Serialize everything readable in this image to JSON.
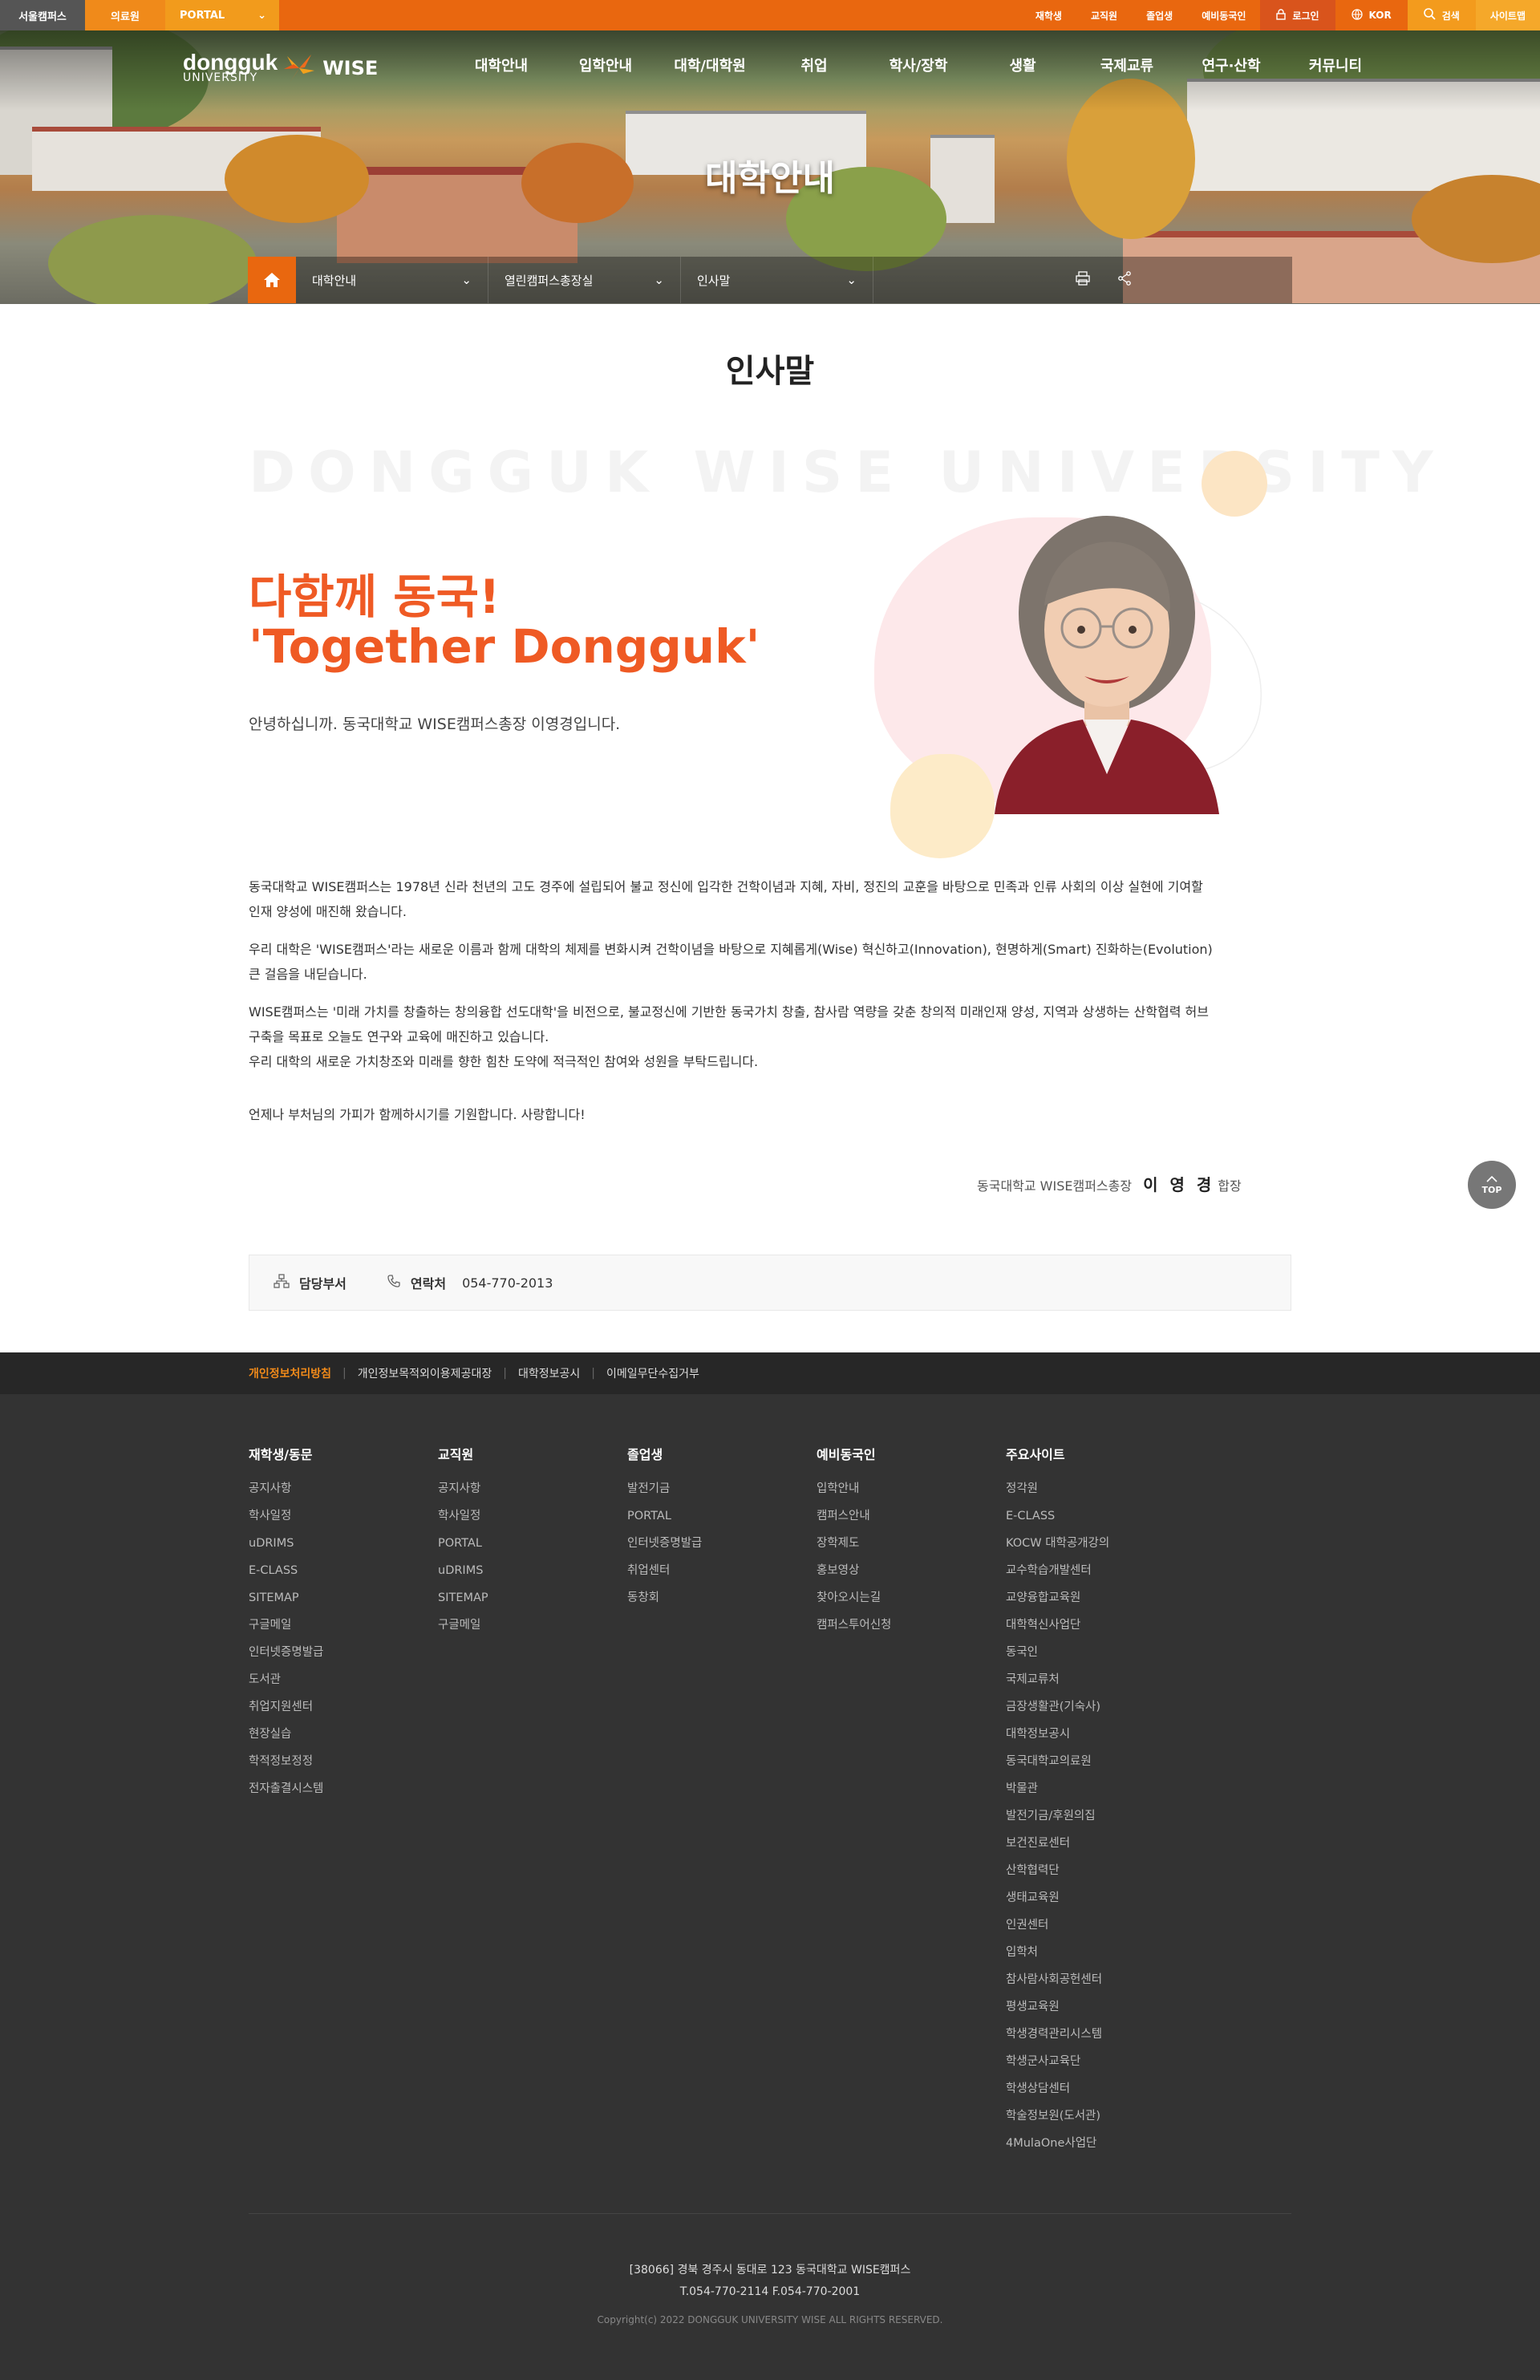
{
  "topbar": {
    "left": [
      "서울캠퍼스",
      "의료원",
      "PORTAL"
    ],
    "right": [
      "재학생",
      "교직원",
      "졸업생",
      "예비동국인"
    ],
    "login": "로그인",
    "lang": "KOR",
    "search": "검색",
    "sitemap": "사이트맵"
  },
  "header": {
    "logo_main": "dongguk",
    "logo_sub": "UNIVERSITY",
    "logo_wise": "WISE",
    "gnb": [
      "대학안내",
      "입학안내",
      "대학/대학원",
      "취업",
      "학사/장학",
      "생활",
      "국제교류",
      "연구·산학",
      "커뮤니티"
    ],
    "hero_title": "대학안내"
  },
  "location": {
    "depth1": "대학안내",
    "depth2": "열린캠퍼스총장실",
    "depth3": "인사말"
  },
  "content": {
    "page_title": "인사말",
    "watermark": "DONGGUK WISE UNIVERSITY",
    "slogan1": "다함께 동국!",
    "slogan2": "'Together Dongguk'",
    "greeting": "안녕하십니까. 동국대학교 WISE캠퍼스총장 이영경입니다.",
    "p1a": "동국대학교 WISE캠퍼스는 1978년 신라 천년의 고도 경주에 설립되어 불교 정신에 입각한 건학이념과 지혜, 자비, 정진의 교훈을 바탕으로 민족과 인류 사회의 이상 실현에 기여할",
    "p1b": "인재 양성에 매진해 왔습니다.",
    "p2a": "우리 대학은 'WISE캠퍼스'라는 새로운 이름과 함께 대학의 체제를 변화시켜 건학이념을 바탕으로 지혜롭게(Wise) 혁신하고(Innovation), 현명하게(Smart) 진화하는(Evolution)",
    "p2b": "큰 걸음을 내딛습니다.",
    "p3a": "WISE캠퍼스는 '미래 가치를 창출하는 창의융합 선도대학'을 비전으로, 불교정신에 기반한 동국가치 창출, 참사람 역량을 갖춘 창의적 미래인재 양성, 지역과 상생하는 산학협력 허브",
    "p3b": "구축을 목표로 오늘도 연구와 교육에 매진하고 있습니다.",
    "p3c": "우리 대학의 새로운 가치창조와 미래를 향한 힘찬 도약에 적극적인 참여와 성원을 부탁드립니다.",
    "p4": "언제나 부처님의 가피가 함께하시기를 기원합니다. 사랑합니다!",
    "sign_org": "동국대학교 WISE캠퍼스총장",
    "sign_name": "이 영 경",
    "sign_suffix": "합장",
    "top_btn": "TOP"
  },
  "contact": {
    "dept_label": "담당부서",
    "phone_label": "연락처",
    "phone": "054-770-2013"
  },
  "footer": {
    "links": [
      "개인정보처리방침",
      "개인정보목적외이용제공대장",
      "대학정보공시",
      "이메일무단수집거부"
    ],
    "columns": [
      {
        "title": "재학생/동문",
        "items": [
          "공지사항",
          "학사일정",
          "uDRIMS",
          "E-CLASS",
          "SITEMAP",
          "구글메일",
          "인터넷증명발급",
          "도서관",
          "취업지원센터",
          "현장실습",
          "학적정보정정",
          "전자출결시스템"
        ]
      },
      {
        "title": "교직원",
        "items": [
          "공지사항",
          "학사일정",
          "PORTAL",
          "uDRIMS",
          "SITEMAP",
          "구글메일"
        ]
      },
      {
        "title": "졸업생",
        "items": [
          "발전기금",
          "PORTAL",
          "인터넷증명발급",
          "취업센터",
          "동창회"
        ]
      },
      {
        "title": "예비동국인",
        "items": [
          "입학안내",
          "캠퍼스안내",
          "장학제도",
          "홍보영상",
          "찾아오시는길",
          "캠퍼스투어신청"
        ]
      },
      {
        "title": "주요사이트",
        "items": [
          "정각원",
          "E-CLASS",
          "KOCW 대학공개강의",
          "교수학습개발센터",
          "교양융합교육원",
          "대학혁신사업단",
          "동국인",
          "국제교류처",
          "금장생활관(기숙사)",
          "대학정보공시",
          "동국대학교의료원",
          "박물관",
          "발전기금/후원의집",
          "보건진료센터",
          "산학협력단",
          "생태교육원",
          "인권센터",
          "입학처",
          "참사람사회공헌센터",
          "평생교육원",
          "학생경력관리시스템",
          "학생군사교육단",
          "학생상담센터",
          "학술정보원(도서관)",
          "4MulaOne사업단"
        ]
      }
    ],
    "address": "[38066] 경북 경주시 동대로 123 동국대학교 WISE캠퍼스",
    "tel": "T.054-770-2114 F.054-770-2001",
    "copyright": "Copyright(c) 2022 DONGGUK UNIVERSITY WISE ALL RIGHTS RESERVED."
  },
  "colors": {
    "brand_orange": "#e9670f",
    "slogan": "#ef5a24",
    "footer_bg": "#333333"
  }
}
